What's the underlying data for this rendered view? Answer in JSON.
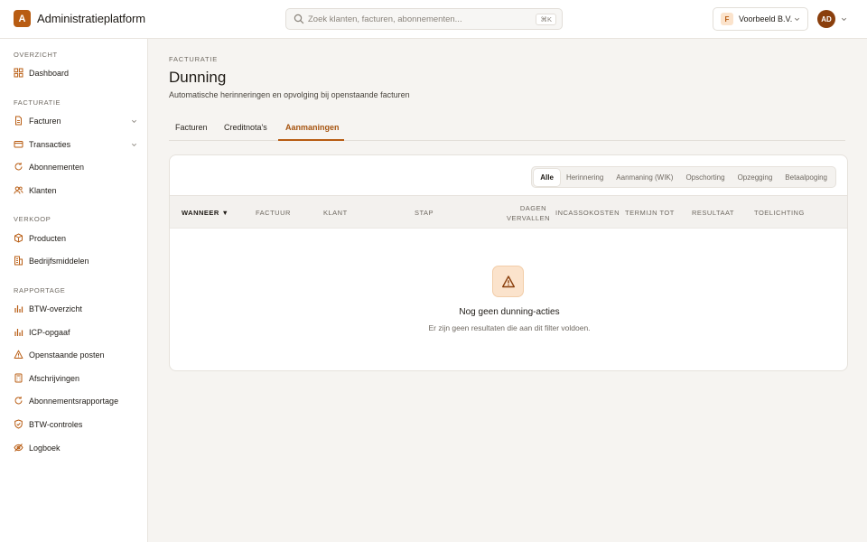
{
  "app": {
    "logo_letter": "A",
    "title": "Administratieplatform"
  },
  "search": {
    "placeholder": "Zoek klanten, facturen, abonnementen...",
    "shortcut": "⌘K"
  },
  "org": {
    "initial": "F",
    "name": "Voorbeeld B.V."
  },
  "user": {
    "initials": "AD"
  },
  "sidebar": {
    "groups": [
      {
        "title": "OVERZICHT",
        "items": [
          {
            "label": "Dashboard",
            "icon": "grid-icon"
          }
        ]
      },
      {
        "title": "FACTURATIE",
        "items": [
          {
            "label": "Facturen",
            "icon": "document-icon",
            "expandable": true
          },
          {
            "label": "Transacties",
            "icon": "card-icon",
            "expandable": true
          },
          {
            "label": "Abonnementen",
            "icon": "refresh-icon"
          },
          {
            "label": "Klanten",
            "icon": "users-icon"
          }
        ]
      },
      {
        "title": "VERKOOP",
        "items": [
          {
            "label": "Producten",
            "icon": "box-icon"
          },
          {
            "label": "Bedrijfsmiddelen",
            "icon": "building-icon"
          }
        ]
      },
      {
        "title": "RAPPORTAGE",
        "items": [
          {
            "label": "BTW-overzicht",
            "icon": "bar-chart-icon"
          },
          {
            "label": "ICP-opgaaf",
            "icon": "bar-chart-icon"
          },
          {
            "label": "Openstaande posten",
            "icon": "warning-icon"
          },
          {
            "label": "Afschrijvingen",
            "icon": "calculator-icon"
          },
          {
            "label": "Abonnementsrapportage",
            "icon": "refresh-icon"
          },
          {
            "label": "BTW-controles",
            "icon": "shield-check-icon"
          },
          {
            "label": "Logboek",
            "icon": "eye-off-icon"
          }
        ]
      }
    ]
  },
  "page": {
    "eyebrow": "FACTURATIE",
    "title": "Dunning",
    "subtitle": "Automatische herinneringen en opvolging bij openstaande facturen",
    "tabs": [
      "Facturen",
      "Creditnota's",
      "Aanmaningen"
    ],
    "active_tab": "Aanmaningen"
  },
  "filters": {
    "options": [
      "Alle",
      "Herinnering",
      "Aanmaning (WIK)",
      "Opschorting",
      "Opzegging",
      "Betaalpoging"
    ],
    "selected": "Alle"
  },
  "table": {
    "columns": [
      "WANNEER",
      "FACTUUR",
      "KLANT",
      "STAP",
      "DAGEN",
      "VERVALLEN",
      "INCASSOKOSTEN",
      "TERMIJN TOT",
      "RESULTAAT",
      "TOELICHTING"
    ],
    "sort_indicator": "▼"
  },
  "empty": {
    "title": "Nog geen dunning-acties",
    "text": "Er zijn geen resultaten die aan dit filter voldoen."
  },
  "colors": {
    "accent": "#b85c12",
    "accent_soft": "#fbe3cc",
    "background": "#f6f4f1"
  }
}
